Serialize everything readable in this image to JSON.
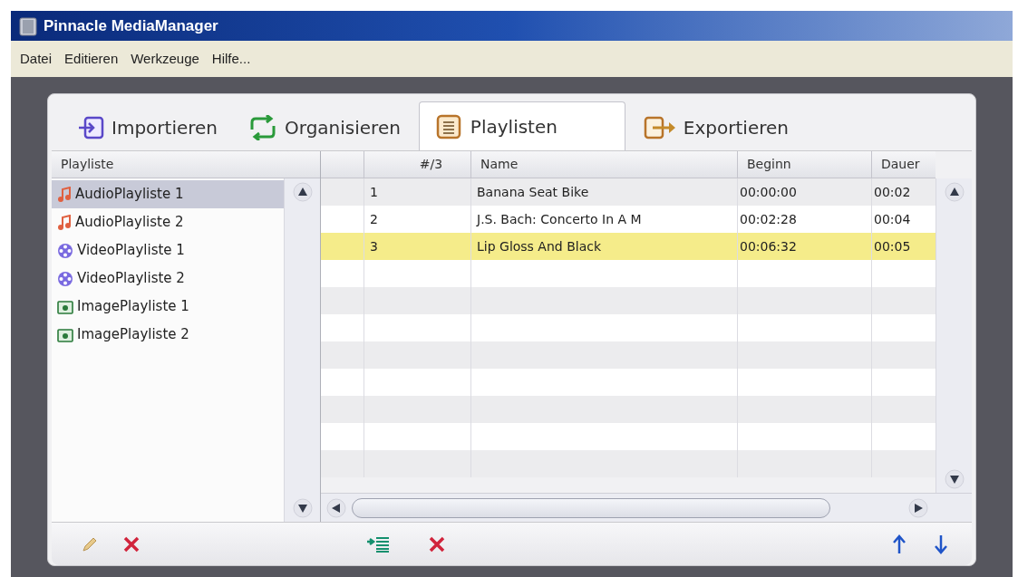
{
  "window": {
    "title": "Pinnacle MediaManager"
  },
  "menu": [
    "Datei",
    "Editieren",
    "Werkzeuge",
    "Hilfe..."
  ],
  "tabs": [
    {
      "label": "Importieren",
      "kind": "import",
      "selected": false
    },
    {
      "label": "Organisieren",
      "kind": "organize",
      "selected": false
    },
    {
      "label": "Playlisten",
      "kind": "playlist",
      "selected": true
    },
    {
      "label": "Exportieren",
      "kind": "export",
      "selected": false
    }
  ],
  "playlists": {
    "header": "Playliste",
    "items": [
      {
        "label": "AudioPlayliste 1",
        "kind": "audio",
        "selected": true
      },
      {
        "label": "AudioPlayliste 2",
        "kind": "audio",
        "selected": false
      },
      {
        "label": "VideoPlayliste 1",
        "kind": "video",
        "selected": false
      },
      {
        "label": "VideoPlayliste 2",
        "kind": "video",
        "selected": false
      },
      {
        "label": "ImagePlayliste 1",
        "kind": "image",
        "selected": false
      },
      {
        "label": "ImagePlayliste 2",
        "kind": "image",
        "selected": false
      }
    ]
  },
  "table": {
    "columns": [
      "#/3",
      "Name",
      "Beginn",
      "Dauer"
    ],
    "rows": [
      {
        "cells": [
          "1",
          "Banana Seat Bike",
          "00:00:00",
          "00:02"
        ],
        "selected": false
      },
      {
        "cells": [
          "2",
          "J.S. Bach: Concerto In A M",
          "00:02:28",
          "00:04"
        ],
        "selected": false
      },
      {
        "cells": [
          "3",
          "Lip Gloss And Black",
          "00:06:32",
          "00:05"
        ],
        "selected": true
      }
    ]
  }
}
